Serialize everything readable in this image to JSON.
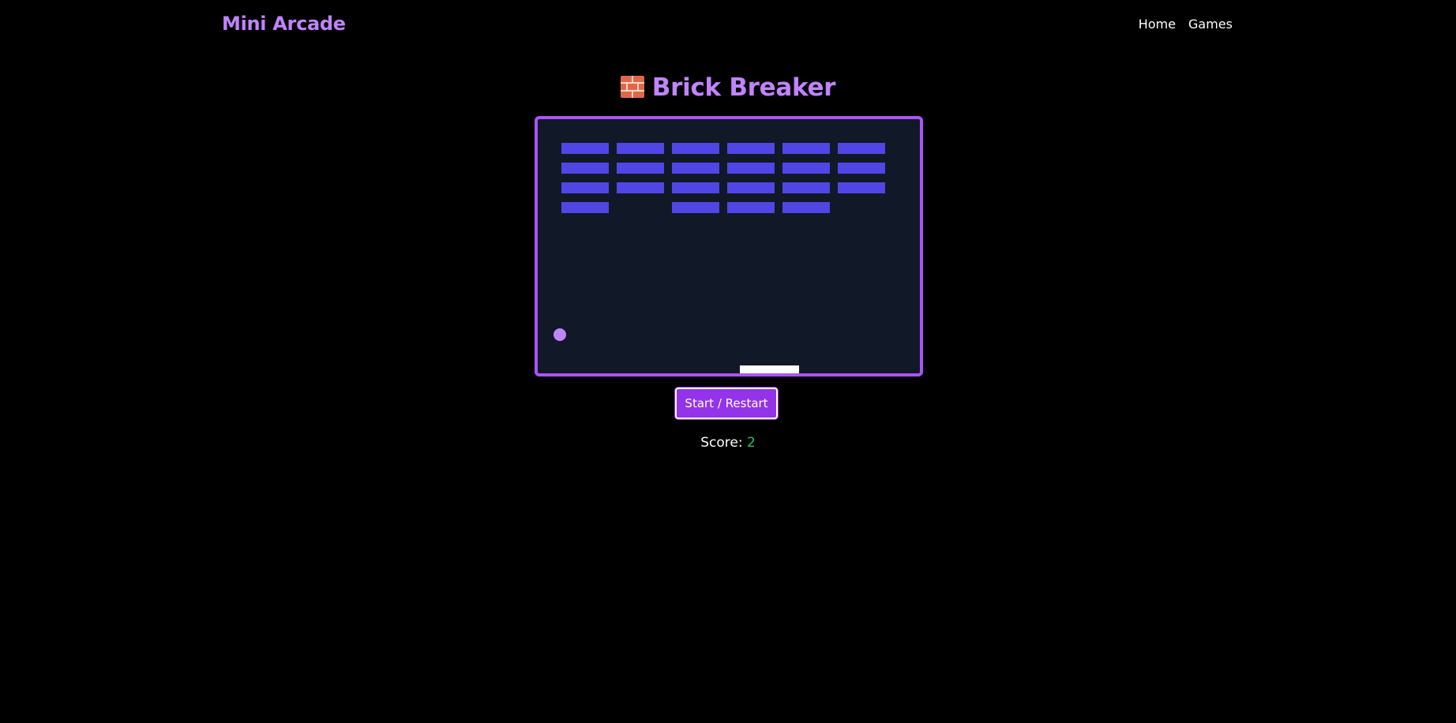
{
  "header": {
    "brand": "Mini Arcade",
    "nav": [
      {
        "label": "Home"
      },
      {
        "label": "Games"
      }
    ]
  },
  "game": {
    "title_icon": "brick-emoji-icon",
    "title": "Brick Breaker",
    "bricks": {
      "rows": 4,
      "cols": 6,
      "present": [
        [
          true,
          true,
          true,
          true,
          true,
          true
        ],
        [
          true,
          true,
          true,
          true,
          true,
          true
        ],
        [
          true,
          true,
          true,
          true,
          true,
          true
        ],
        [
          true,
          false,
          true,
          true,
          true,
          false
        ]
      ]
    },
    "start_button_label": "Start / Restart",
    "score_label": "Score:",
    "score_value": "2"
  },
  "colors": {
    "accent": "#c084fc",
    "board_border": "#a855f7",
    "board_bg": "#111827",
    "brick": "#4f46e5",
    "button": "#9333ea",
    "score_value": "#22c55e"
  }
}
